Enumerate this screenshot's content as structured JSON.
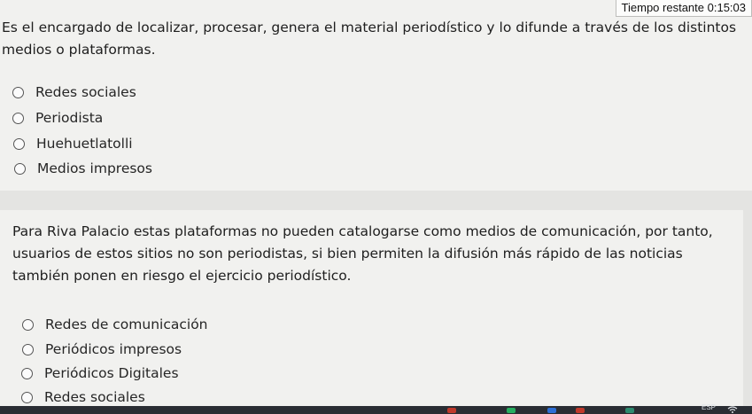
{
  "timer": {
    "label": "Tiempo restante",
    "value": "0:15:03"
  },
  "question1": {
    "text": "Es el encargado de localizar, procesar, genera el material periodístico y lo difunde a través de los distintos medios o plataformas.",
    "options": [
      "Redes sociales",
      "Periodista",
      "Huehuetlatolli",
      "Medios impresos"
    ]
  },
  "question2": {
    "text": "Para Riva Palacio estas plataformas no pueden catalogarse como medios de comunicación, por tanto, usuarios de estos sitios no son periodistas, si bien permiten la difusión más rápido de las noticias también ponen en riesgo el ejercicio periodístico.",
    "options": [
      "Redes de comunicación",
      "Periódicos impresos",
      "Periódicos Digitales",
      "Redes sociales"
    ]
  },
  "taskbar": {
    "language": "ESP",
    "icon_colors": [
      "#c0392b",
      "#27ae60",
      "#2d6fd6",
      "#c0392b",
      "#2d8a6f"
    ]
  }
}
